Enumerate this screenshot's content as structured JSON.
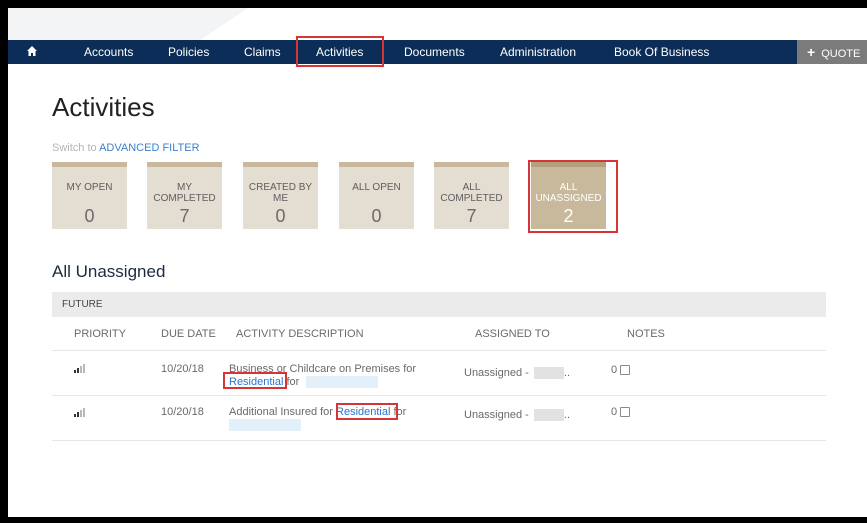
{
  "nav": {
    "items": [
      "Accounts",
      "Policies",
      "Claims",
      "Activities",
      "Documents",
      "Administration",
      "Book Of Business"
    ],
    "active": "Activities",
    "quote_label": "QUOTE"
  },
  "page": {
    "title": "Activities",
    "switch_prefix": "Switch to",
    "switch_link": "ADVANCED FILTER"
  },
  "tiles": [
    {
      "label": "MY OPEN",
      "count": "0"
    },
    {
      "label": "MY COMPLETED",
      "count": "7"
    },
    {
      "label": "CREATED BY ME",
      "count": "0"
    },
    {
      "label": "ALL OPEN",
      "count": "0"
    },
    {
      "label": "ALL COMPLETED",
      "count": "7"
    },
    {
      "label": "ALL UNASSIGNED",
      "count": "2"
    }
  ],
  "section": {
    "title": "All Unassigned",
    "group": "FUTURE"
  },
  "table": {
    "headers": [
      "PRIORITY",
      "DUE DATE",
      "ACTIVITY DESCRIPTION",
      "ASSIGNED TO",
      "NOTES"
    ],
    "rows": [
      {
        "due": "10/20/18",
        "desc_before": "Business or Childcare on Premises for",
        "link": "Residential",
        "desc_after": "for",
        "assigned": "Unassigned -",
        "notes": "0"
      },
      {
        "due": "10/20/18",
        "desc_before": "Additional Insured for",
        "link": "Residential",
        "desc_after": "for",
        "assigned": "Unassigned -",
        "notes": "0"
      }
    ]
  },
  "colors": {
    "navbar": "#0c2d57",
    "tile": "#e3ddd2",
    "tile_active": "#c8b99c",
    "highlight": "#d63535",
    "link": "#2f73c9"
  }
}
